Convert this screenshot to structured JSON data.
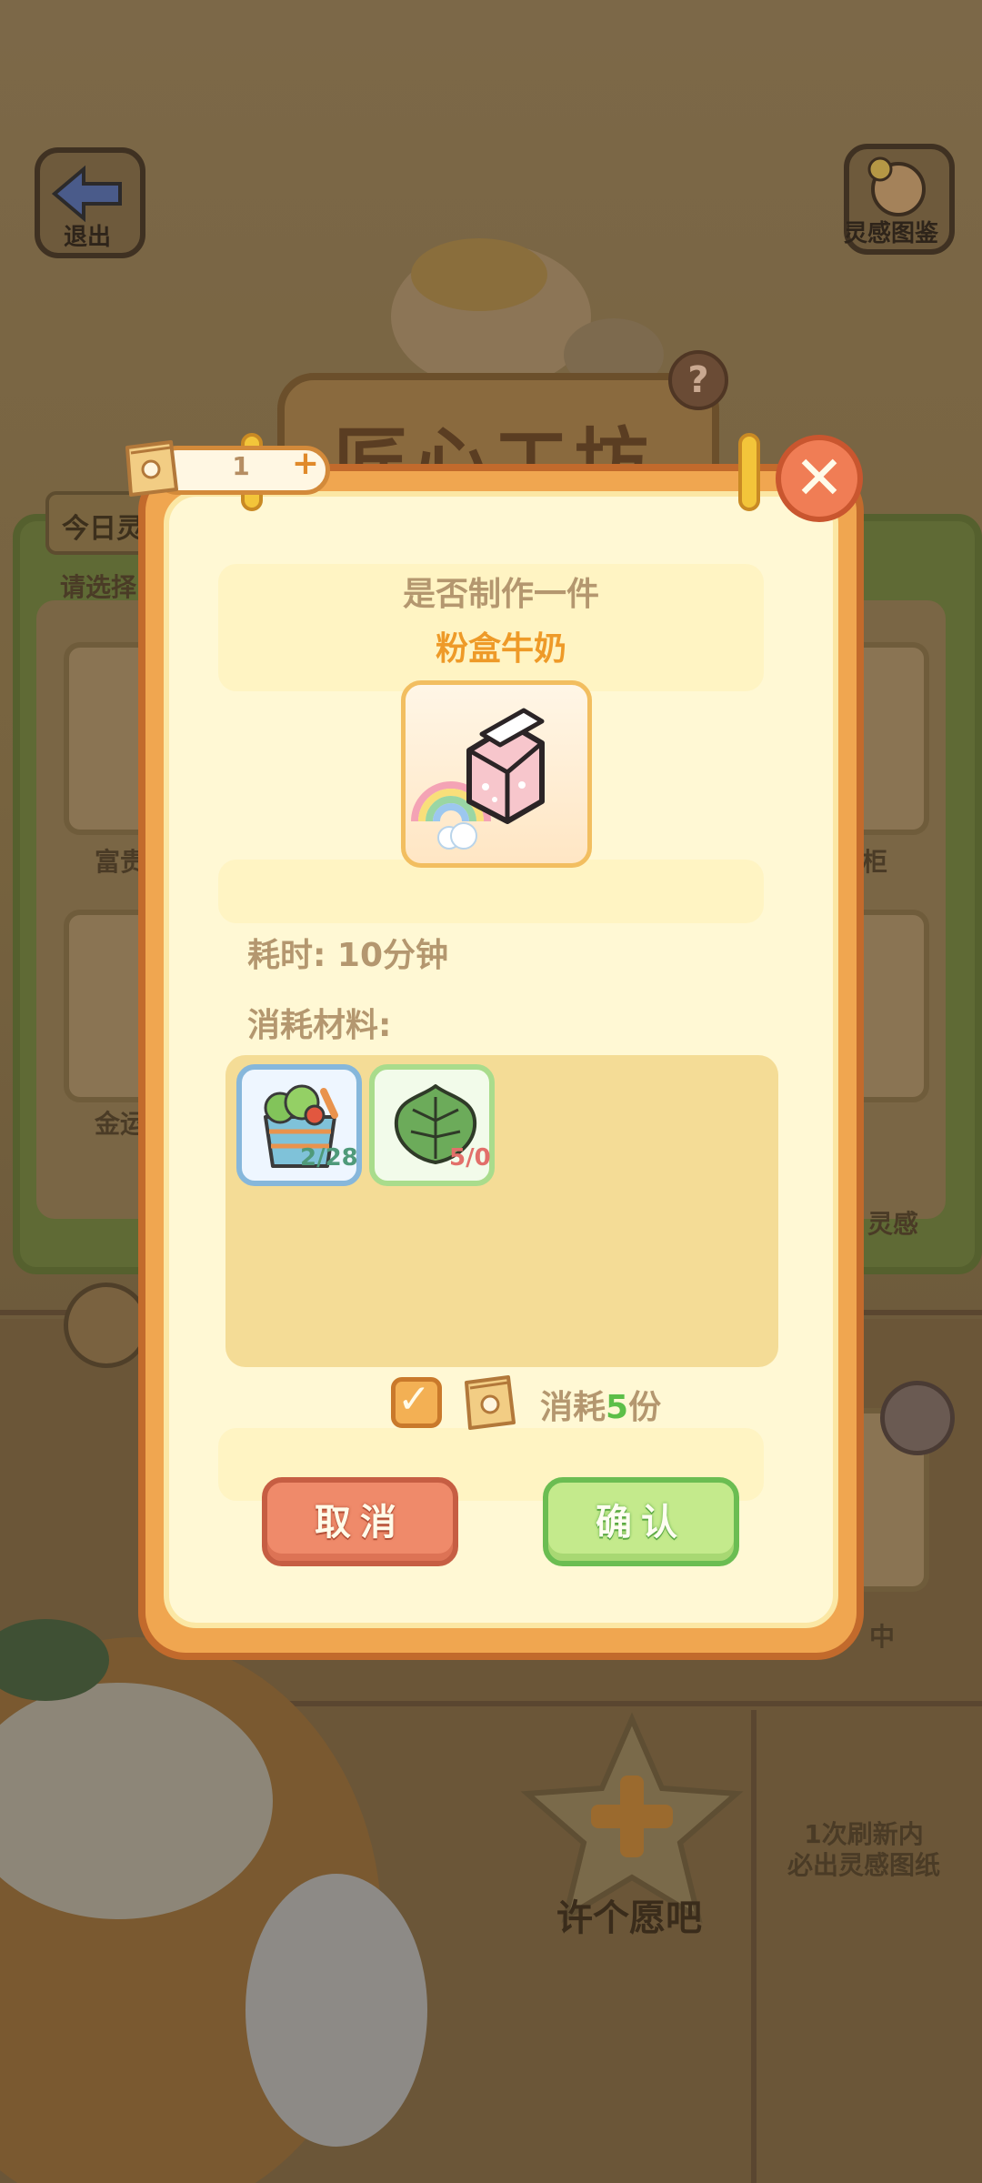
{
  "background": {
    "exit_label": "退出",
    "gallery_label": "灵感图鉴",
    "workshop_sign": "匠心工坊",
    "help_mark": "?",
    "today_tab": "今日灵",
    "select_hint": "请选择",
    "card_labels": [
      "富贵",
      "金运",
      "柜",
      "灵感"
    ],
    "in_progress": "中",
    "wish_label": "许个愿吧",
    "refresh_note_line1": "1次刷新内",
    "refresh_note_line2": "必出灵感图纸"
  },
  "dialog": {
    "counter_value": "1",
    "counter_plus": "+",
    "close_symbol": "✕",
    "question": "是否制作一件",
    "item_name": "粉盒牛奶",
    "time_label": "耗时: 10分钟",
    "materials_label": "消耗材料:",
    "materials": [
      {
        "icon": "vegetable-bag-icon",
        "count": "2/28"
      },
      {
        "icon": "leaf-icon",
        "count": "5/0"
      }
    ],
    "consume_prefix": "消耗",
    "consume_amount": "5",
    "consume_suffix": "份",
    "cancel_label": "取消",
    "confirm_label": "确认"
  },
  "colors": {
    "dialog_frame": "#f0a650",
    "dialog_fill": "#fff8d4",
    "item_name": "#ee9a28",
    "cancel_button": "#ef8a6a",
    "confirm_button": "#c4ea8c",
    "consume_amount": "#5cbf48"
  }
}
